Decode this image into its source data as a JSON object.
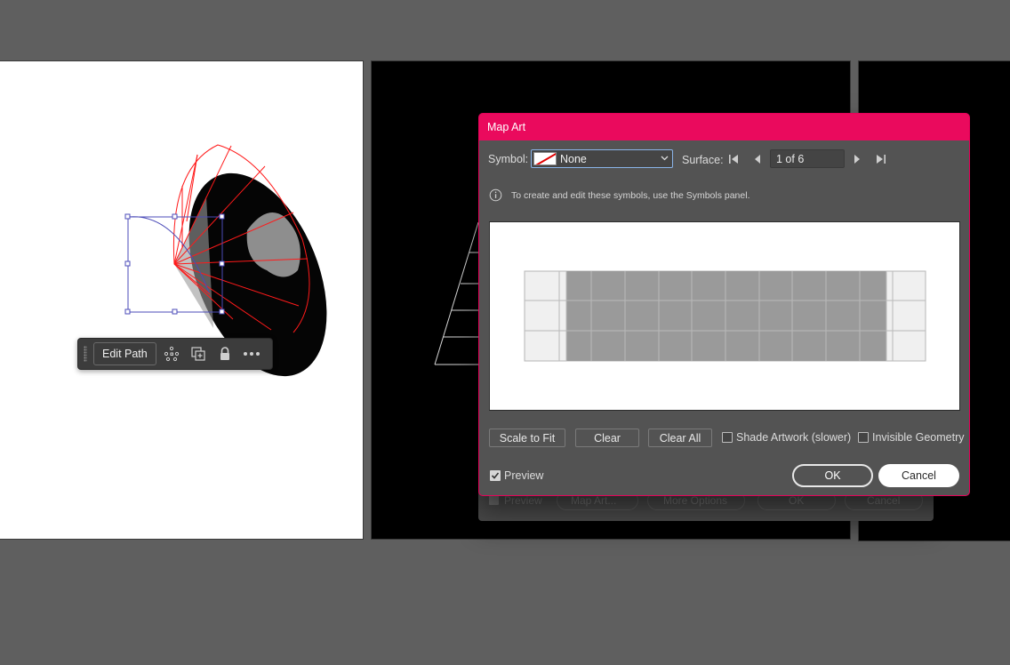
{
  "context_toolbar": {
    "edit_path_label": "Edit Path",
    "icons": [
      "anchor-points-icon",
      "duplicate-icon",
      "lock-icon",
      "more-icon"
    ]
  },
  "ghost_dialog": {
    "preview_label": "Preview",
    "map_art_label": "Map Art...",
    "more_options_label": "More Options",
    "ok_label": "OK",
    "cancel_label": "Cancel"
  },
  "dialog": {
    "title": "Map Art",
    "symbol_label": "Symbol:",
    "symbol_value": "None",
    "surface_label": "Surface:",
    "surface_value": "1 of 6",
    "info_text": "To create and edit these symbols, use the Symbols panel.",
    "buttons": {
      "scale_to_fit": "Scale to Fit",
      "clear": "Clear",
      "clear_all": "Clear All",
      "ok": "OK",
      "cancel": "Cancel"
    },
    "checkboxes": {
      "shade_artwork": {
        "label": "Shade Artwork (slower)",
        "checked": false
      },
      "invisible_geometry": {
        "label": "Invisible Geometry",
        "checked": false
      },
      "preview": {
        "label": "Preview",
        "checked": true
      }
    }
  },
  "colors": {
    "accent": "#ea0a5d",
    "selection": "#4b4bb8",
    "wireframe": "#ff0000"
  }
}
